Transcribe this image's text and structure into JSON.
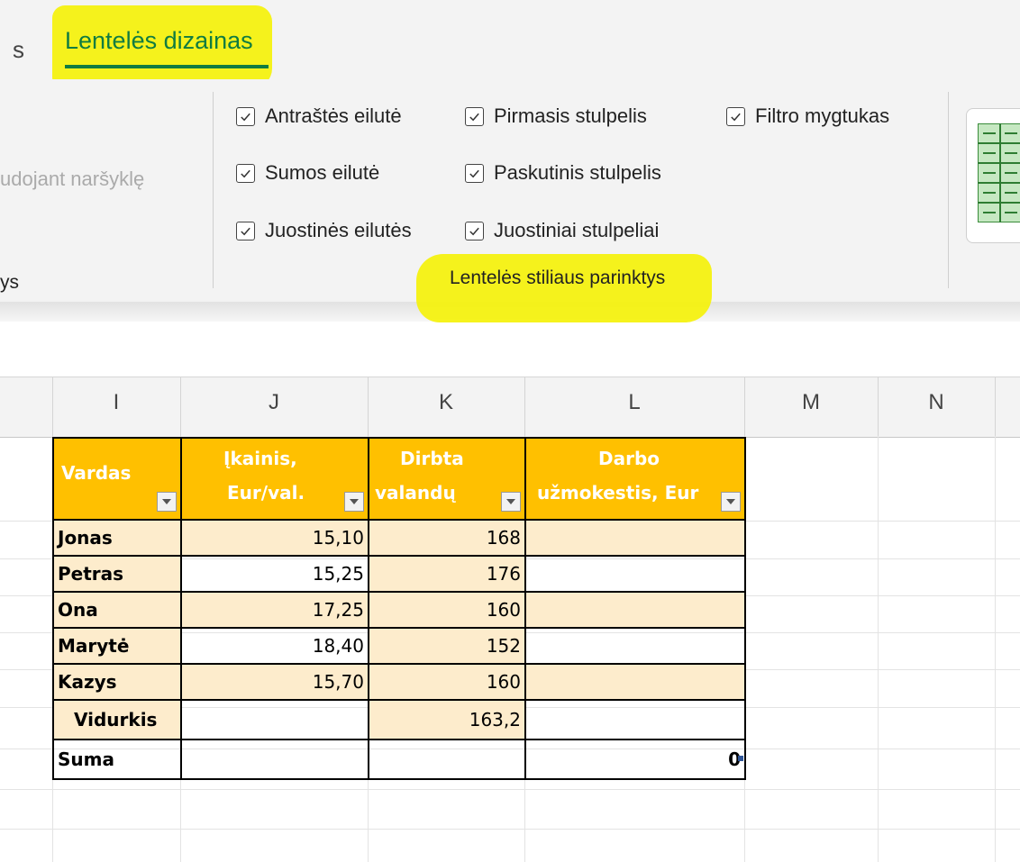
{
  "ribbon": {
    "tab_partial": "s",
    "tab_active": "Lentelės dizainas",
    "left_partial_text": "udojant naršyklę",
    "left_partial_group": "ys",
    "options": [
      {
        "label": "Antraštės eilutė",
        "checked": true
      },
      {
        "label": "Sumos eilutė",
        "checked": true
      },
      {
        "label": "Juostinės eilutės",
        "checked": true
      },
      {
        "label": "Pirmasis stulpelis",
        "checked": true
      },
      {
        "label": "Paskutinis stulpelis",
        "checked": true
      },
      {
        "label": "Juostiniai stulpeliai",
        "checked": true
      },
      {
        "label": "Filtro mygtukas",
        "checked": true
      }
    ],
    "group_label": "Lentelės stiliaus parinktys",
    "highlight_color": "#f5f20a",
    "accent_color": "#107c41"
  },
  "sheet": {
    "columns": [
      "I",
      "J",
      "K",
      "L",
      "M",
      "N"
    ],
    "table": {
      "header_color": "#ffc000",
      "band_color": "#fdeccc",
      "headers": [
        {
          "line1": "Vardas",
          "line2": ""
        },
        {
          "line1": "Įkainis,",
          "line2": "Eur/val."
        },
        {
          "line1": "Dirbta",
          "line2": "valandų"
        },
        {
          "line1": "Darbo",
          "line2": "užmokestis, Eur"
        }
      ],
      "rows": [
        {
          "name": "Jonas",
          "rate": "15,10",
          "hours": "168",
          "pay": ""
        },
        {
          "name": "Petras",
          "rate": "15,25",
          "hours": "176",
          "pay": ""
        },
        {
          "name": "Ona",
          "rate": "17,25",
          "hours": "160",
          "pay": ""
        },
        {
          "name": "Marytė",
          "rate": "18,40",
          "hours": "152",
          "pay": ""
        },
        {
          "name": "Kazys",
          "rate": "15,70",
          "hours": "160",
          "pay": ""
        }
      ],
      "average": {
        "label": "Vidurkis",
        "rate": "",
        "hours": "163,2",
        "pay": ""
      },
      "total": {
        "label": "Suma",
        "rate": "",
        "hours": "",
        "pay": "0"
      }
    }
  }
}
